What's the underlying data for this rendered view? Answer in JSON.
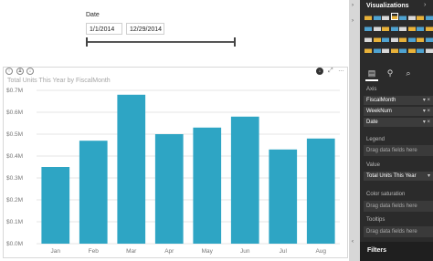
{
  "slicer": {
    "title": "Date",
    "start_date": "1/1/2014",
    "end_date": "12/29/2014"
  },
  "visual": {
    "title": "Total Units This Year by FiscalMonth"
  },
  "chart_data": {
    "type": "bar",
    "categories": [
      "Jan",
      "Feb",
      "Mar",
      "Apr",
      "May",
      "Jun",
      "Jul",
      "Aug"
    ],
    "values": [
      0.35,
      0.47,
      0.68,
      0.5,
      0.53,
      0.58,
      0.43,
      0.48
    ],
    "yticks": [
      "$0.0M",
      "$0.1M",
      "$0.2M",
      "$0.3M",
      "$0.4M",
      "$0.5M",
      "$0.6M",
      "$0.7M"
    ],
    "ylim": [
      0,
      0.7
    ],
    "color": "#2ea5c4",
    "grid": true
  },
  "panel": {
    "title": "Visualizations",
    "axis_label": "Axis",
    "axis_fields": [
      "FiscalMonth",
      "WeekNum",
      "Date"
    ],
    "legend_label": "Legend",
    "legend_placeholder": "Drag data fields here",
    "value_label": "Value",
    "value_field": "Total Units This Year",
    "saturation_label": "Color saturation",
    "saturation_placeholder": "Drag data fields here",
    "tooltips_label": "Tooltips",
    "tooltips_placeholder": "Drag data fields here",
    "filters_label": "Filters"
  }
}
